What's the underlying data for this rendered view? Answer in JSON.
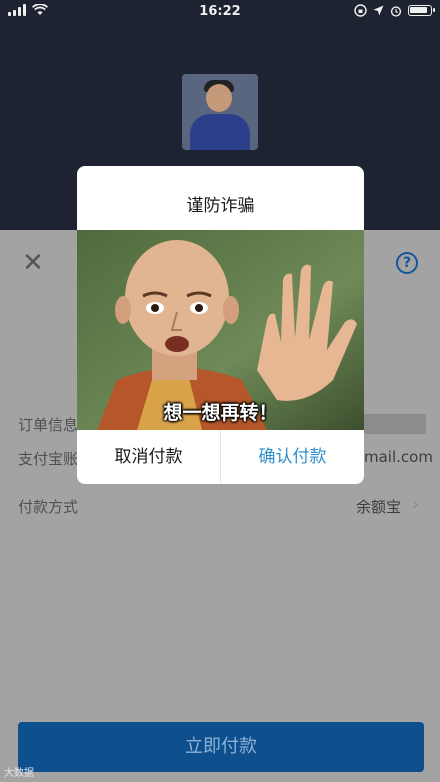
{
  "status_bar": {
    "time": "16:22"
  },
  "modal": {
    "title": "谨防诈骗",
    "caption": "想一想再转！",
    "cancel_label": "取消付款",
    "confirm_label": "确认付款"
  },
  "page": {
    "order_label": "订单信息",
    "account_label": "支付宝账户",
    "account_value_visible": "mail.com",
    "method_label": "付款方式",
    "method_value": "余额宝",
    "pay_button_label": "立即付款"
  },
  "icons": {
    "close": "close-icon",
    "help": "help-icon",
    "chevron": "chevron-right-icon"
  },
  "colors": {
    "accent": "#2f8fc9",
    "pay_button": "#0e4f8e",
    "help": "#15559b"
  },
  "watermark": "大数据"
}
